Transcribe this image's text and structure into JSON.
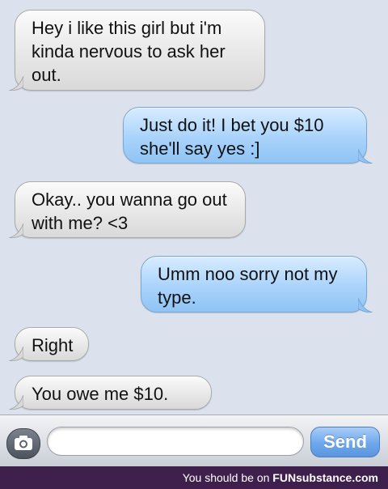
{
  "messages": [
    {
      "text": "Hey i like this girl but i'm kinda nervous to ask her out.",
      "side": "received"
    },
    {
      "text": "Just do it! I bet you $10 she'll say yes :]",
      "side": "sent"
    },
    {
      "text": "Okay.. you wanna go out with me? <3",
      "side": "received"
    },
    {
      "text": "Umm noo sorry not my type.",
      "side": "sent"
    },
    {
      "text": "Right",
      "side": "received"
    },
    {
      "text": "You owe me $10.",
      "side": "received"
    }
  ],
  "composer": {
    "input_value": "",
    "send_label": "Send",
    "camera_icon": "camera-icon"
  },
  "watermark": {
    "prefix": "You should be on",
    "brand": "FUNsubstance.com"
  },
  "colors": {
    "received_bubble": "#e6e6e6",
    "sent_bubble": "#a9d3fb",
    "background": "#dbe2ed",
    "send_button": "#6ea7ec",
    "watermark_bar": "#3f1f4c"
  }
}
